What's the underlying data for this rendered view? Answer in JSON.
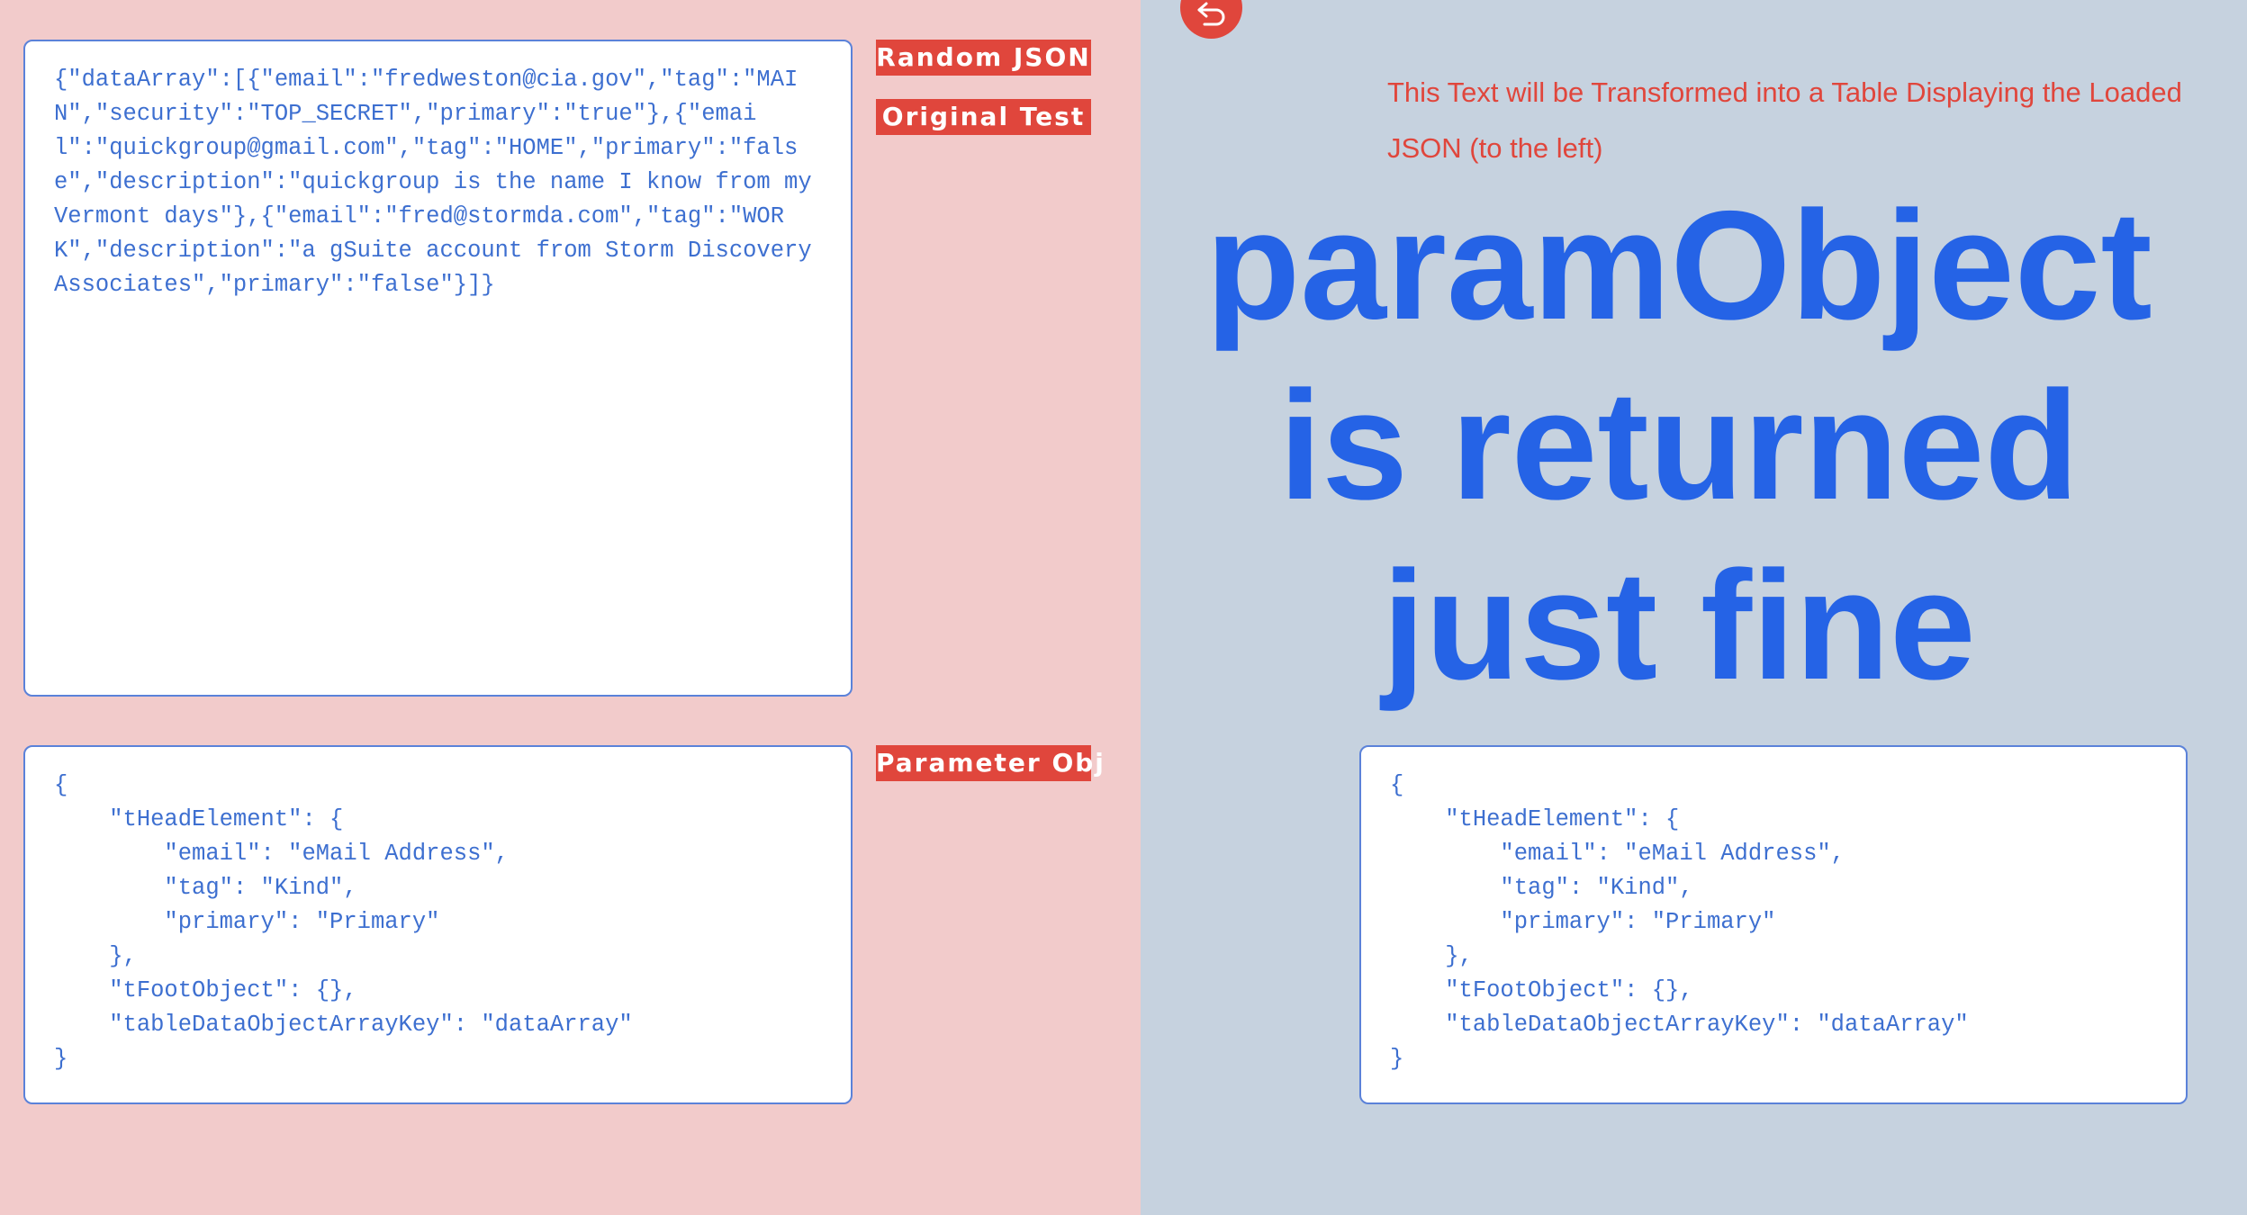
{
  "left_panel": {
    "random_json_text": "{\"dataArray\":[{\"email\":\"fredweston@cia.gov\",\"tag\":\"MAIN\",\"security\":\"TOP_SECRET\",\"primary\":\"true\"},{\"email\":\"quickgroup@gmail.com\",\"tag\":\"HOME\",\"primary\":\"false\",\"description\":\"quickgroup is the name I know from my Vermont days\"},{\"email\":\"fred@stormda.com\",\"tag\":\"WORK\",\"description\":\"a gSuite account from Storm Discovery Associates\",\"primary\":\"false\"}]}",
    "param_obj_text": "{\n    \"tHeadElement\": {\n        \"email\": \"eMail Address\",\n        \"tag\": \"Kind\",\n        \"primary\": \"Primary\"\n    },\n    \"tFootObject\": {},\n    \"tableDataObjectArrayKey\": \"dataArray\"\n}"
  },
  "labels": {
    "random_json": "Random JSON",
    "original_test": "Original Test",
    "parameter_obj": "Parameter Obj"
  },
  "right_panel": {
    "back_icon": "undo-arrow-icon",
    "transform_note": "This Text will be Transformed into a Table Displaying the Loaded JSON (to the left)",
    "headline_lines": [
      "paramObject",
      "is returned",
      "just fine"
    ],
    "param_obj_text": "{\n    \"tHeadElement\": {\n        \"email\": \"eMail Address\",\n        \"tag\": \"Kind\",\n        \"primary\": \"Primary\"\n    },\n    \"tFootObject\": {},\n    \"tableDataObjectArrayKey\": \"dataArray\"\n}"
  },
  "colors": {
    "left_background": "#f2cbcb",
    "right_background": "#c6d2df",
    "accent_red": "#e0463c",
    "code_blue": "#3d6fd0",
    "headline_blue": "#2563e6"
  }
}
